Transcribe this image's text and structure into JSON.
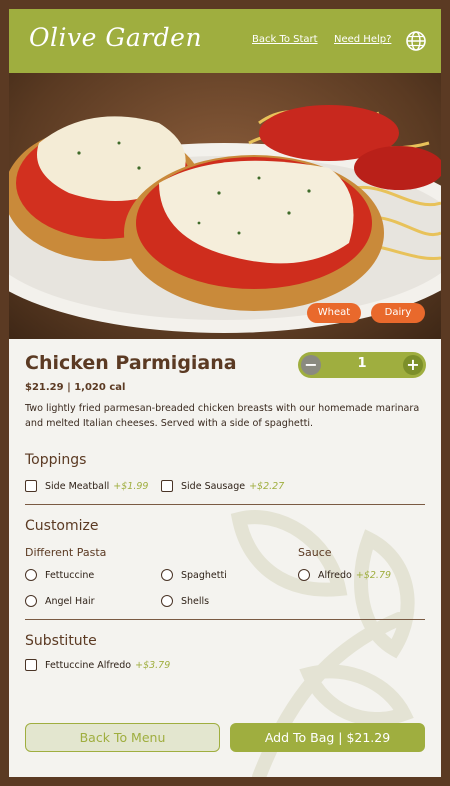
{
  "header": {
    "brand": "Olive Garden",
    "back_to_start": "Back To Start",
    "need_help": "Need Help?"
  },
  "colors": {
    "brand_green": "#9fae3f",
    "brown": "#5b3a23",
    "allergen_orange": "#e9692c"
  },
  "hero": {
    "allergens": [
      "Wheat",
      "Dairy"
    ]
  },
  "item": {
    "name": "Chicken Parmigiana",
    "price_cal": "$21.29 | 1,020 cal",
    "description": "Two lightly fried parmesan-breaded chicken breasts with our homemade marinara and melted Italian cheeses. Served with a side of spaghetti."
  },
  "quantity": {
    "minus": "−",
    "value": "1",
    "plus": "+"
  },
  "toppings": {
    "title": "Toppings",
    "options": [
      {
        "label": "Side Meatball",
        "extra": "+$1.99"
      },
      {
        "label": "Side Sausage",
        "extra": "+$2.27"
      }
    ]
  },
  "customize": {
    "title": "Customize",
    "pasta_label": "Different Pasta",
    "pasta": [
      "Fettuccine",
      "Spaghetti",
      "Angel Hair",
      "Shells"
    ],
    "sauce_label": "Sauce",
    "sauce": [
      {
        "label": "Alfredo",
        "extra": "+$2.79"
      }
    ]
  },
  "substitute": {
    "title": "Substitute",
    "options": [
      {
        "label": "Fettuccine Alfredo",
        "extra": "+$3.79"
      }
    ]
  },
  "footer": {
    "back": "Back To Menu",
    "add": "Add To Bag | $21.29"
  }
}
